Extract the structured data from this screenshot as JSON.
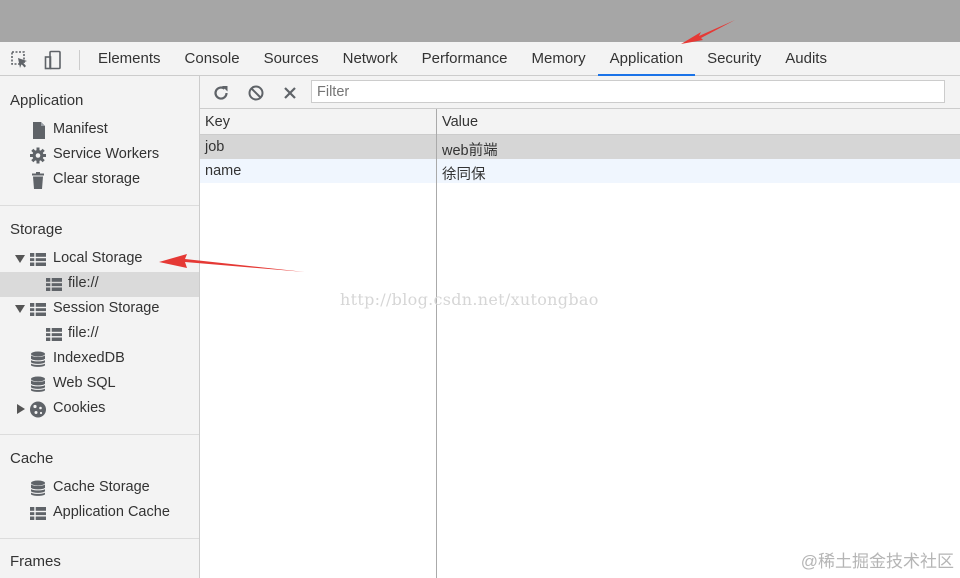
{
  "toolbar": {
    "tabs": [
      {
        "label": "Elements"
      },
      {
        "label": "Console"
      },
      {
        "label": "Sources"
      },
      {
        "label": "Network"
      },
      {
        "label": "Performance"
      },
      {
        "label": "Memory"
      },
      {
        "label": "Application",
        "active": true
      },
      {
        "label": "Security"
      },
      {
        "label": "Audits"
      }
    ],
    "inspect_icon": "element-picker-icon",
    "device_icon": "device-toolbar-icon"
  },
  "sidebar": {
    "application": {
      "title": "Application",
      "items": [
        {
          "label": "Manifest",
          "icon": "document-icon"
        },
        {
          "label": "Service Workers",
          "icon": "gear-icon"
        },
        {
          "label": "Clear storage",
          "icon": "trash-icon"
        }
      ]
    },
    "storage": {
      "title": "Storage",
      "local_storage": {
        "label": "Local Storage",
        "child": "file://"
      },
      "session_storage": {
        "label": "Session Storage",
        "child": "file://"
      },
      "indexeddb": "IndexedDB",
      "websql": "Web SQL",
      "cookies": "Cookies"
    },
    "cache": {
      "title": "Cache",
      "items": [
        {
          "label": "Cache Storage",
          "icon": "database-icon"
        },
        {
          "label": "Application Cache",
          "icon": "grid-icon"
        }
      ]
    },
    "frames": {
      "title": "Frames"
    }
  },
  "main": {
    "filter_placeholder": "Filter",
    "columns": {
      "key": "Key",
      "value": "Value"
    },
    "rows": [
      {
        "key": "job",
        "value": "web前端"
      },
      {
        "key": "name",
        "value": "徐同保"
      }
    ]
  },
  "watermark": "http://blog.csdn.net/xutongbao",
  "corner_watermark": "@稀土掘金技术社区",
  "colors": {
    "accent": "#1a73e8",
    "arrow": "#e53935",
    "selected_row": "#d6d6d6",
    "alt_row": "#f0f6fe"
  }
}
